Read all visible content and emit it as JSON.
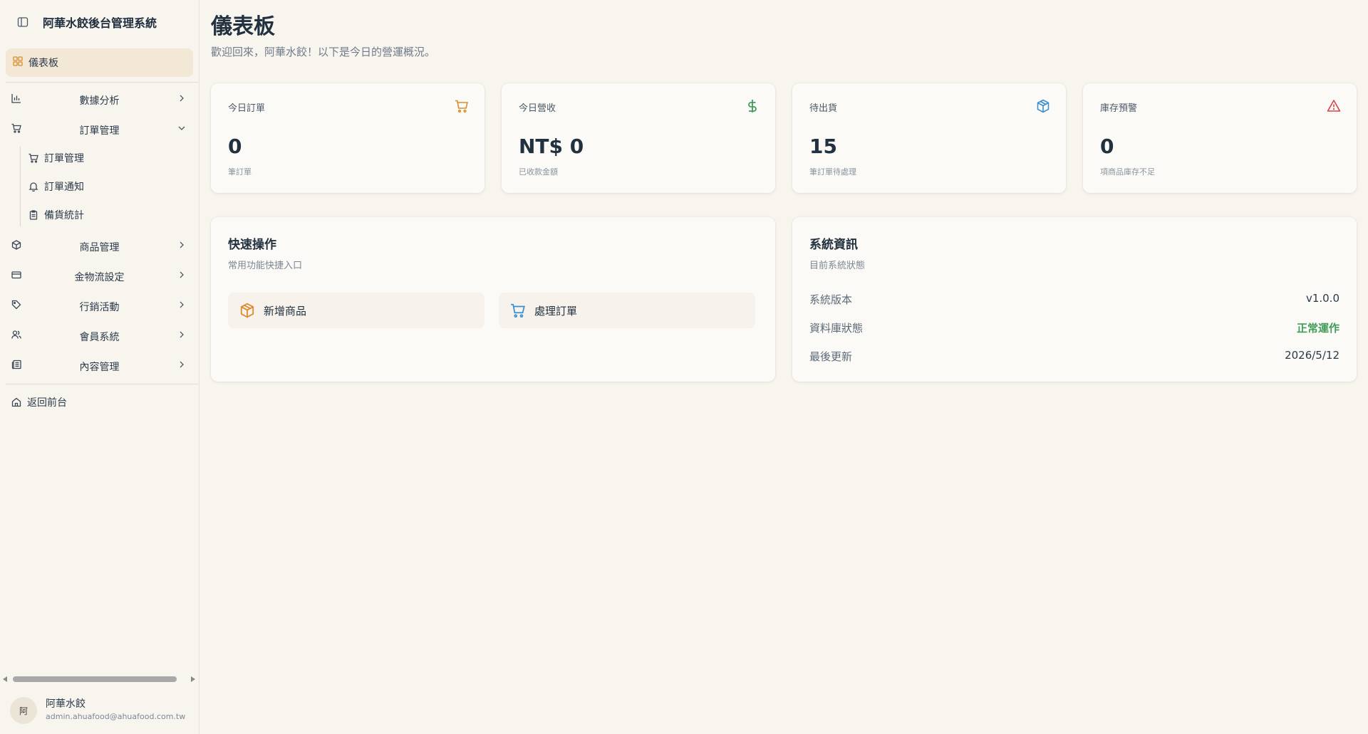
{
  "sidebar": {
    "title": "阿華水餃後台管理系統",
    "dashboard": "儀表板",
    "items": [
      {
        "label": "數據分析"
      },
      {
        "label": "訂單管理"
      },
      {
        "label": "商品管理"
      },
      {
        "label": "金物流設定"
      },
      {
        "label": "行銷活動"
      },
      {
        "label": "會員系統"
      },
      {
        "label": "內容管理"
      }
    ],
    "sub_items": [
      {
        "label": "訂單管理"
      },
      {
        "label": "訂單通知"
      },
      {
        "label": "備貨統計"
      }
    ],
    "back_home": "返回前台",
    "user": {
      "avatar": "阿",
      "name": "阿華水餃",
      "email": "admin.ahuafood@ahuafood.com.tw"
    }
  },
  "header": {
    "title": "儀表板",
    "subtitle": "歡迎回來，阿華水餃！以下是今日的營運概況。"
  },
  "stats": [
    {
      "label": "今日訂單",
      "value": "0",
      "note": "筆訂單",
      "icon": "cart-icon",
      "color": "#d98c2b"
    },
    {
      "label": "今日營收",
      "value": "NT$ 0",
      "note": "已收款金額",
      "icon": "dollar-icon",
      "color": "#3f9d59"
    },
    {
      "label": "待出貨",
      "value": "15",
      "note": "筆訂單待處理",
      "icon": "package-icon",
      "color": "#3b8fd1"
    },
    {
      "label": "庫存預警",
      "value": "0",
      "note": "項商品庫存不足",
      "icon": "alert-triangle-icon",
      "color": "#d64545"
    }
  ],
  "quick_actions": {
    "title": "快速操作",
    "subtitle": "常用功能快捷入口",
    "buttons": [
      {
        "label": "新增商品",
        "icon": "package-icon"
      },
      {
        "label": "處理訂單",
        "icon": "cart-icon"
      }
    ]
  },
  "system_info": {
    "title": "系統資訊",
    "subtitle": "目前系統狀態",
    "rows": [
      {
        "key": "系統版本",
        "value": "v1.0.0"
      },
      {
        "key": "資料庫狀態",
        "value": "正常運作"
      },
      {
        "key": "最後更新",
        "value": "2026/5/12"
      }
    ]
  }
}
